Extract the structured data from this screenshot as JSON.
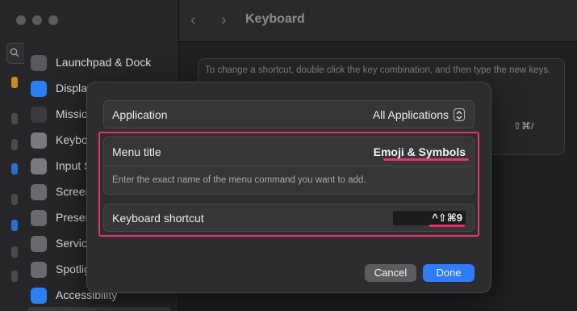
{
  "window": {
    "title": "Keyboard",
    "back_glyph": "‹",
    "forward_glyph": "›"
  },
  "sidebar": {
    "items": [
      {
        "label": "Launchpad & Dock",
        "icon": "launchpad-icon",
        "color": "#5a5a5e"
      },
      {
        "label": "Displays",
        "icon": "displays-icon",
        "color": "#2a7ff2"
      },
      {
        "label": "Mission Control",
        "icon": "mission-control-icon",
        "color": "#3a3a3e"
      },
      {
        "label": "Keyboard",
        "icon": "keyboard-icon",
        "color": "#7a7a7e"
      },
      {
        "label": "Input Sources",
        "icon": "input-sources-icon",
        "color": "#7a7a7e"
      },
      {
        "label": "Screenshots",
        "icon": "screenshot-icon",
        "color": "#6a6a6e"
      },
      {
        "label": "Presenter Overlay",
        "icon": "presenter-icon",
        "color": "#6a6a6e"
      },
      {
        "label": "Services",
        "icon": "services-icon",
        "color": "#6a6a6e"
      },
      {
        "label": "Spotlight",
        "icon": "spotlight-icon",
        "color": "#6a6a6e"
      },
      {
        "label": "Accessibility",
        "icon": "accessibility-icon",
        "color": "#2a7ff2"
      }
    ]
  },
  "background": {
    "instruction": "To change a shortcut, double click the key combination, and then type the new keys.",
    "shortcut": "⇧⌘/"
  },
  "dialog": {
    "application_label": "Application",
    "application_value": "All Applications",
    "menu_title_label": "Menu title",
    "menu_title_value": "Emoji & Symbols",
    "help_text": "Enter the exact name of the menu command you want to add.",
    "shortcut_label": "Keyboard shortcut",
    "shortcut_value": "^⇧⌘9",
    "cancel_label": "Cancel",
    "done_label": "Done"
  },
  "colors": {
    "accent": "#2f7cf6",
    "annotation": "#e8336a"
  }
}
